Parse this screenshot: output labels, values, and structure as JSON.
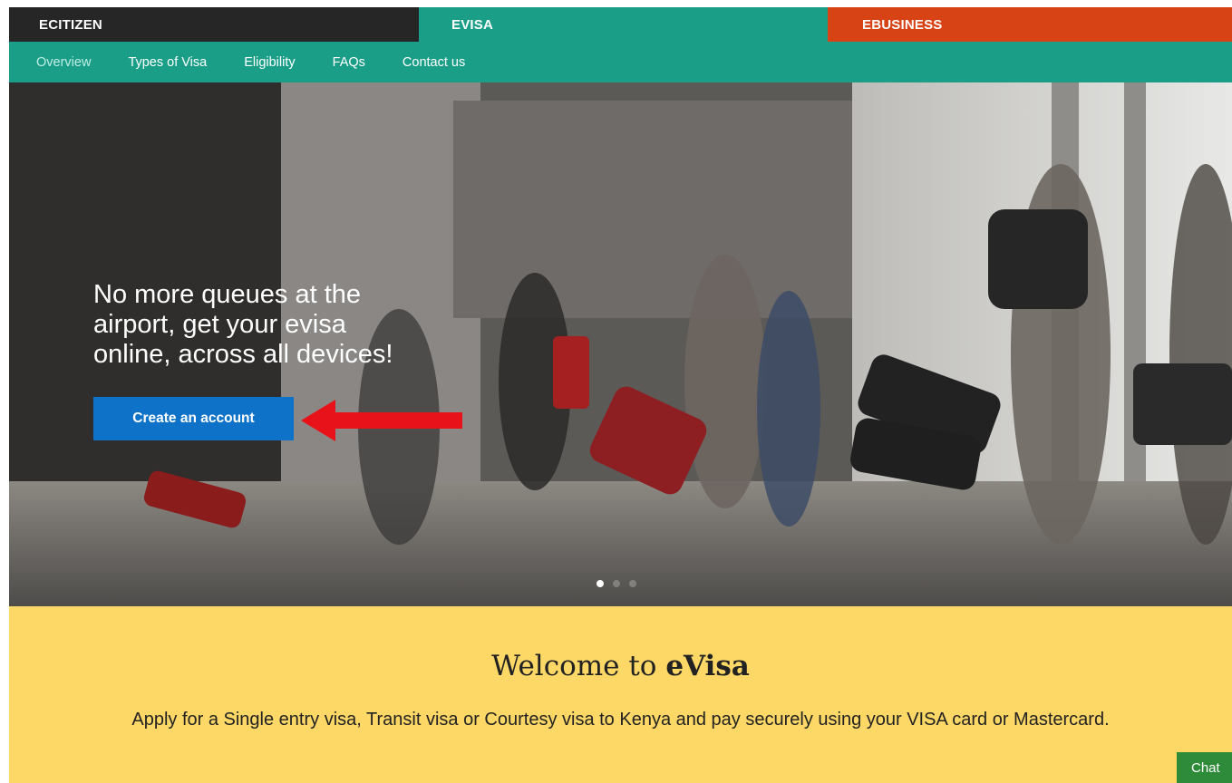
{
  "topbar": {
    "ecitizen": "ECITIZEN",
    "evisa": "EVISA",
    "ebusiness": "EBUSINESS"
  },
  "nav": {
    "items": [
      "Overview",
      "Types of Visa",
      "Eligibility",
      "FAQs",
      "Contact us"
    ],
    "active": "Overview"
  },
  "hero": {
    "headline_line1": "No more queues at the",
    "headline_line2": "airport, get your evisa",
    "headline_line3": "online, across all devices!",
    "cta_label": "Create an account",
    "slides": 3,
    "active_slide": 1
  },
  "welcome": {
    "title_prefix": "Welcome to ",
    "title_brand": "eVisa",
    "body": "Apply for a Single entry visa, Transit visa or Courtesy visa to Kenya and pay securely using your VISA card or Mastercard."
  },
  "chat": {
    "label": "Chat"
  },
  "colors": {
    "ecitizen_bg": "#262626",
    "evisa_bg": "#1b9e88",
    "ebusiness_bg": "#d84315",
    "cta_bg": "#0f72c9",
    "welcome_bg": "#fdd866",
    "arrow": "#e8121b"
  },
  "icons": [
    "red-arrow-icon",
    "slide-dot-icon"
  ]
}
